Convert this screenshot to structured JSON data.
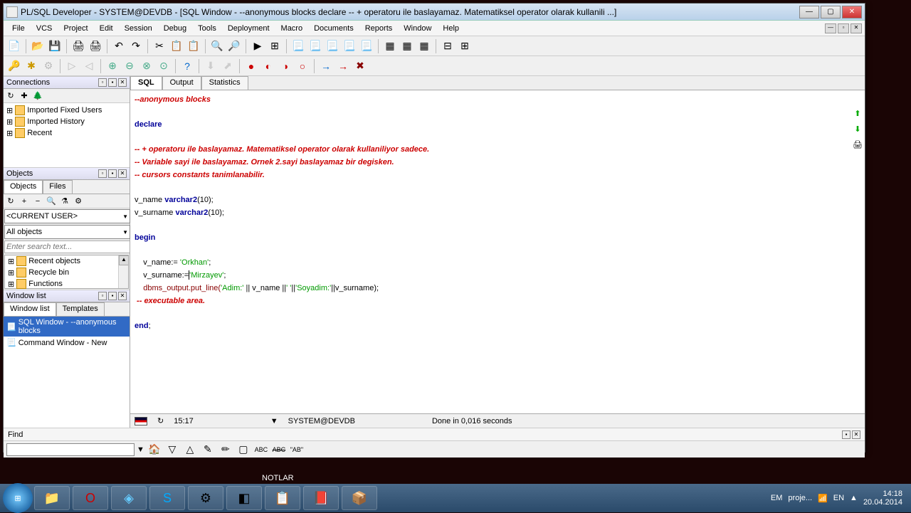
{
  "title": "PL/SQL Developer - SYSTEM@DEVDB - [SQL Window - --anonymous blocks declare -- + operatoru ile baslayamaz. Matematiksel operator olarak kullanili ...]",
  "menu": {
    "file": "File",
    "vcs": "VCS",
    "project": "Project",
    "edit": "Edit",
    "session": "Session",
    "debug": "Debug",
    "tools": "Tools",
    "deployment": "Deployment",
    "macro": "Macro",
    "documents": "Documents",
    "reports": "Reports",
    "window": "Window",
    "help": "Help"
  },
  "panels": {
    "connections": "Connections",
    "objects": "Objects",
    "window_list": "Window list"
  },
  "conn_tree": {
    "fixed": "Imported Fixed Users",
    "history": "Imported History",
    "recent": "Recent"
  },
  "obj_tabs": {
    "objects": "Objects",
    "files": "Files"
  },
  "obj_combo1": "<CURRENT USER>",
  "obj_combo2": "All objects",
  "obj_search_ph": "Enter search text...",
  "obj_list": {
    "recent": "Recent objects",
    "recycle": "Recycle bin",
    "functions": "Functions"
  },
  "wl_tabs": {
    "wl": "Window list",
    "tpl": "Templates"
  },
  "wl_items": {
    "sql": "SQL Window - --anonymous blocks",
    "cmd": "Command Window - New"
  },
  "ed_tabs": {
    "sql": "SQL",
    "output": "Output",
    "stats": "Statistics"
  },
  "code": {
    "c1": "--anonymous blocks",
    "kw_declare": "declare",
    "c2": "-- + operatoru ile baslayamaz. Matematiksel operator olarak kullaniliyor sadece.",
    "c3": "-- Variable sayi ile baslayamaz. Ornek 2.sayi baslayamaz bir degisken.",
    "c4": "-- cursors constants tanimlanabilir.",
    "d1a": "v_name ",
    "d1b": "varchar2",
    "d1c": "(10);",
    "d2a": "v_surname ",
    "d2b": "varchar2",
    "d2c": "(10);",
    "kw_begin": "begin",
    "b1a": "    v_name:= ",
    "b1b": "'Orkhan'",
    "b1c": ";",
    "b2a": "    v_surname:=",
    "b2b": "'Mirzayev'",
    "b2c": ";",
    "b3a": "    dbms_output.put_line(",
    "b3b": "'Adim:'",
    "b3c": " || v_name ||",
    "b3d": "' '",
    "b3e": "||",
    "b3f": "'Soyadim:'",
    "b3g": "||v_surname);",
    "c5": " -- executable area.",
    "kw_end": "end",
    "end_sc": ";"
  },
  "status": {
    "pos": "15:17",
    "conn": "SYSTEM@DEVDB",
    "time": "Done in 0,016 seconds"
  },
  "find": {
    "label": "Find"
  },
  "desktop": {
    "notlar": "NOTLAR"
  },
  "tray": {
    "lang1": "EM",
    "proj": "proje...",
    "lang2": "EN",
    "time": "14:18",
    "date": "20.04.2014"
  }
}
